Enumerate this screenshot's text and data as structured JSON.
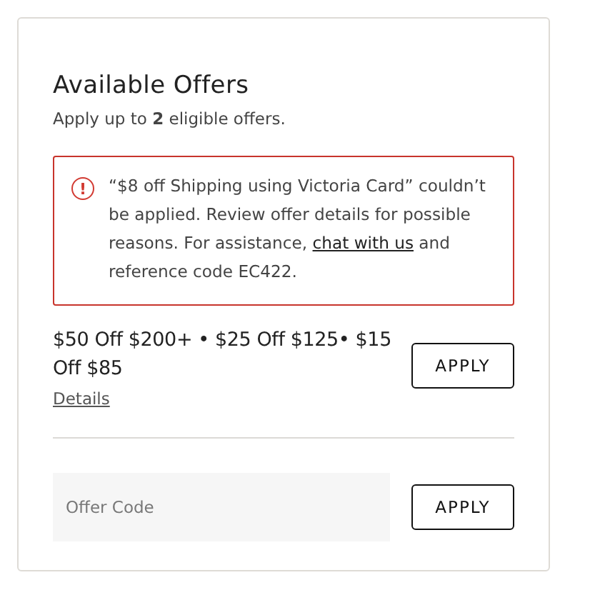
{
  "title": "Available Offers",
  "subtitle": "Apply up to **2** eligible offers.",
  "alert": {
    "icon": "!",
    "message": "“$8 off Shipping using Victoria Card” couldn’t be applied. Review offer details for possible reasons. For assistance,",
    "link": "chat with us",
    "suffix": "and reference code EC422."
  },
  "offer": {
    "text": "$50 Off $200+ • $25 Off $125• $15 Off $85",
    "details": "Details",
    "button": "APPLY"
  },
  "code_field": {
    "placeholder": "Offer Code",
    "button": "APPLY"
  }
}
